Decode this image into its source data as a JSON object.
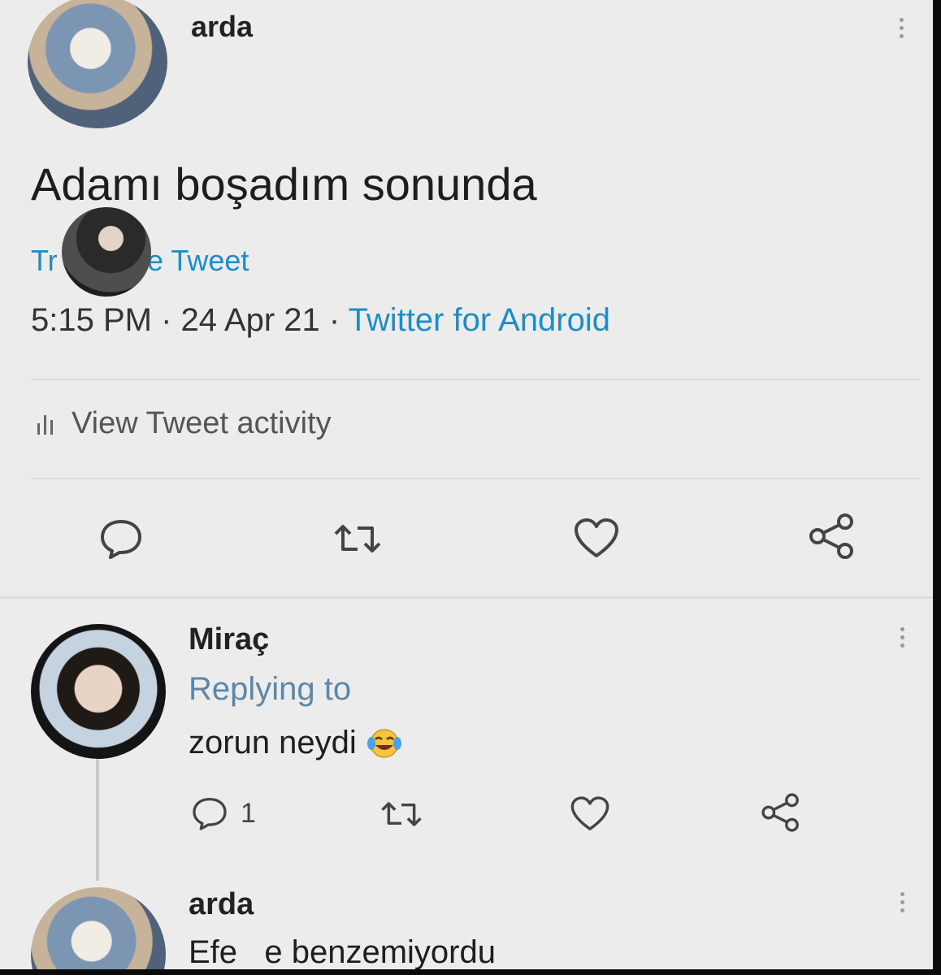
{
  "main_tweet": {
    "author": "arda",
    "text": "Adamı boşadım sonunda",
    "translate_label_start": "Tr",
    "translate_label_end": "e Tweet",
    "time": "5:15 PM",
    "separator1": "·",
    "date": "24 Apr 21",
    "separator2": "·",
    "source": "Twitter for Android",
    "activity_label": "View Tweet activity",
    "actions": [
      "reply-icon",
      "retweet-icon",
      "like-icon",
      "share-icon"
    ]
  },
  "replies": [
    {
      "author": "Miraç",
      "replying_to": "Replying to",
      "text": "zorun neydi",
      "emoji": "laughing-crying-emoji",
      "reply_count": "1"
    },
    {
      "author": "arda",
      "text": "Efe   e benzemiyordu"
    }
  ],
  "colors": {
    "background": "#ececec",
    "link_blue": "#1b8ec8",
    "text": "#222222",
    "icon_gray": "#444444"
  }
}
